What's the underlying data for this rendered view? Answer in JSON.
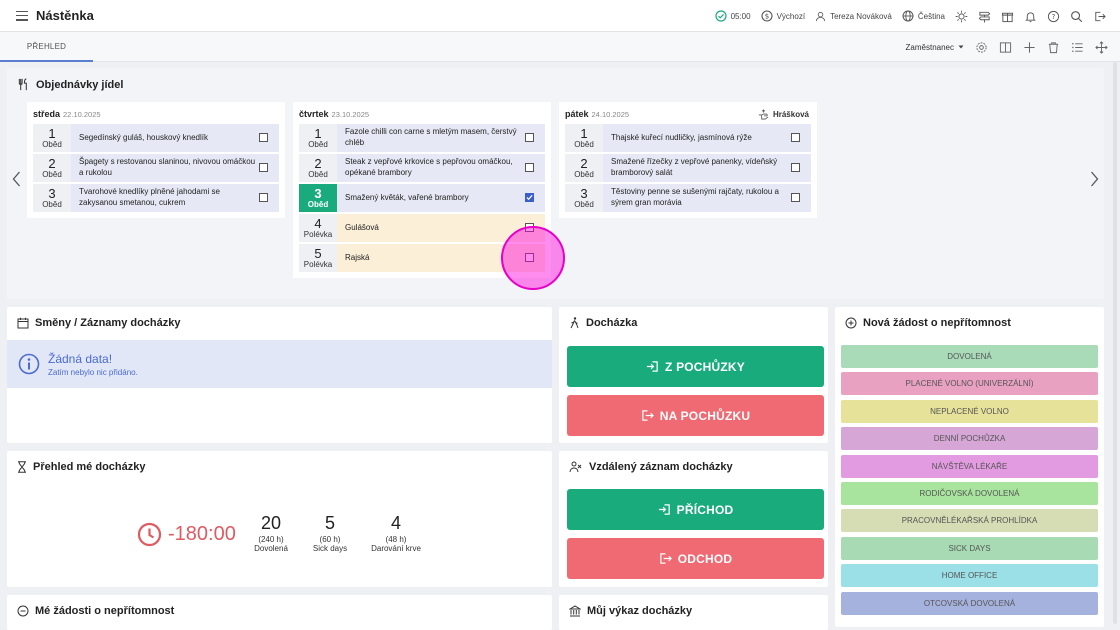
{
  "header": {
    "title": "Nástěnka",
    "time": "05:00",
    "tag": "Výchozí",
    "user": "Tereza Nováková",
    "language": "Čeština"
  },
  "tabs": {
    "active": "PŘEHLED",
    "role": "Zaměstnanec"
  },
  "orders": {
    "title": "Objednávky jídel",
    "days": [
      {
        "name": "středa",
        "date": "22.10.2025",
        "who": "",
        "meals": [
          {
            "num": "1",
            "type": "Oběd",
            "text": "Segedínský guláš, houskový knedlík",
            "checked": false,
            "soup": false
          },
          {
            "num": "2",
            "type": "Oběd",
            "text": "Špagety s restovanou slaninou, nivovou omáčkou a rukolou",
            "checked": false,
            "soup": false
          },
          {
            "num": "3",
            "type": "Oběd",
            "text": "Tvarohové knedlíky plněné jahodami se zakysanou smetanou, cukrem",
            "checked": false,
            "soup": false
          }
        ]
      },
      {
        "name": "čtvrtek",
        "date": "23.10.2025",
        "who": "",
        "meals": [
          {
            "num": "1",
            "type": "Oběd",
            "text": "Fazole chilli con carne s mletým masem, čerstvý chléb",
            "checked": false,
            "soup": false
          },
          {
            "num": "2",
            "type": "Oběd",
            "text": "Steak z vepřové krkovice s pepřovou omáčkou, opékané brambory",
            "checked": false,
            "soup": false
          },
          {
            "num": "3",
            "type": "Oběd",
            "text": "Smažený květák, vařené brambory",
            "checked": true,
            "soup": false
          },
          {
            "num": "4",
            "type": "Polévka",
            "text": "Gulášová",
            "checked": false,
            "soup": true
          },
          {
            "num": "5",
            "type": "Polévka",
            "text": "Rajská",
            "checked": false,
            "soup": true
          }
        ]
      },
      {
        "name": "pátek",
        "date": "24.10.2025",
        "who": "Hrášková",
        "meals": [
          {
            "num": "1",
            "type": "Oběd",
            "text": "Thajské kuřecí nudličky, jasmínová rýže",
            "checked": false,
            "soup": false
          },
          {
            "num": "2",
            "type": "Oběd",
            "text": "Smažené řízečky z vepřové panenky, vídeňský bramborový salát",
            "checked": false,
            "soup": false
          },
          {
            "num": "3",
            "type": "Oběd",
            "text": "Těstoviny penne se sušenými rajčaty, rukolou a sýrem gran morávia",
            "checked": false,
            "soup": false
          }
        ]
      }
    ]
  },
  "shifts": {
    "title": "Směny / Záznamy docházky",
    "empty_title": "Žádná data!",
    "empty_text": "Zatím nebylo nic přidáno."
  },
  "attendance": {
    "title": "Docházka",
    "btn_in": "Z POCHŮZKY",
    "btn_out": "NA POCHŮZKU"
  },
  "remote": {
    "title": "Vzdálený záznam docházky",
    "btn_in": "PŘÍCHOD",
    "btn_out": "ODCHOD"
  },
  "overview": {
    "title": "Přehled mé docházky",
    "balance": "-180:00",
    "stats": [
      {
        "value": "20",
        "hours": "(240 h)",
        "label": "Dovolená"
      },
      {
        "value": "5",
        "hours": "(60 h)",
        "label": "Sick days"
      },
      {
        "value": "4",
        "hours": "(48 h)",
        "label": "Darování krve"
      }
    ]
  },
  "requests": {
    "title": "Mé žádosti o nepřítomnost"
  },
  "report": {
    "title": "Můj výkaz docházky"
  },
  "new_absence": {
    "title": "Nová žádost o nepřítomnost",
    "items": [
      {
        "label": "DOVOLENÁ",
        "color": "#a9dbb9"
      },
      {
        "label": "PLACENÉ VOLNO (UNIVERZÁLNÍ)",
        "color": "#e9a1c2"
      },
      {
        "label": "NEPLACENÉ VOLNO",
        "color": "#e6e29a"
      },
      {
        "label": "DENNÍ POCHŮZKA",
        "color": "#d5a6d6"
      },
      {
        "label": "NÁVŠTĚVA LÉKAŘE",
        "color": "#e29be0"
      },
      {
        "label": "RODIČOVSKÁ DOVOLENÁ",
        "color": "#a9e49e"
      },
      {
        "label": "PRACOVNĚLÉKAŘSKÁ PROHLÍDKA",
        "color": "#d6dcb4"
      },
      {
        "label": "SICK DAYS",
        "color": "#a8dbb4"
      },
      {
        "label": "HOME OFFICE",
        "color": "#9be0e6"
      },
      {
        "label": "OTCOVSKÁ DOVOLENÁ",
        "color": "#a5b2de"
      }
    ]
  }
}
